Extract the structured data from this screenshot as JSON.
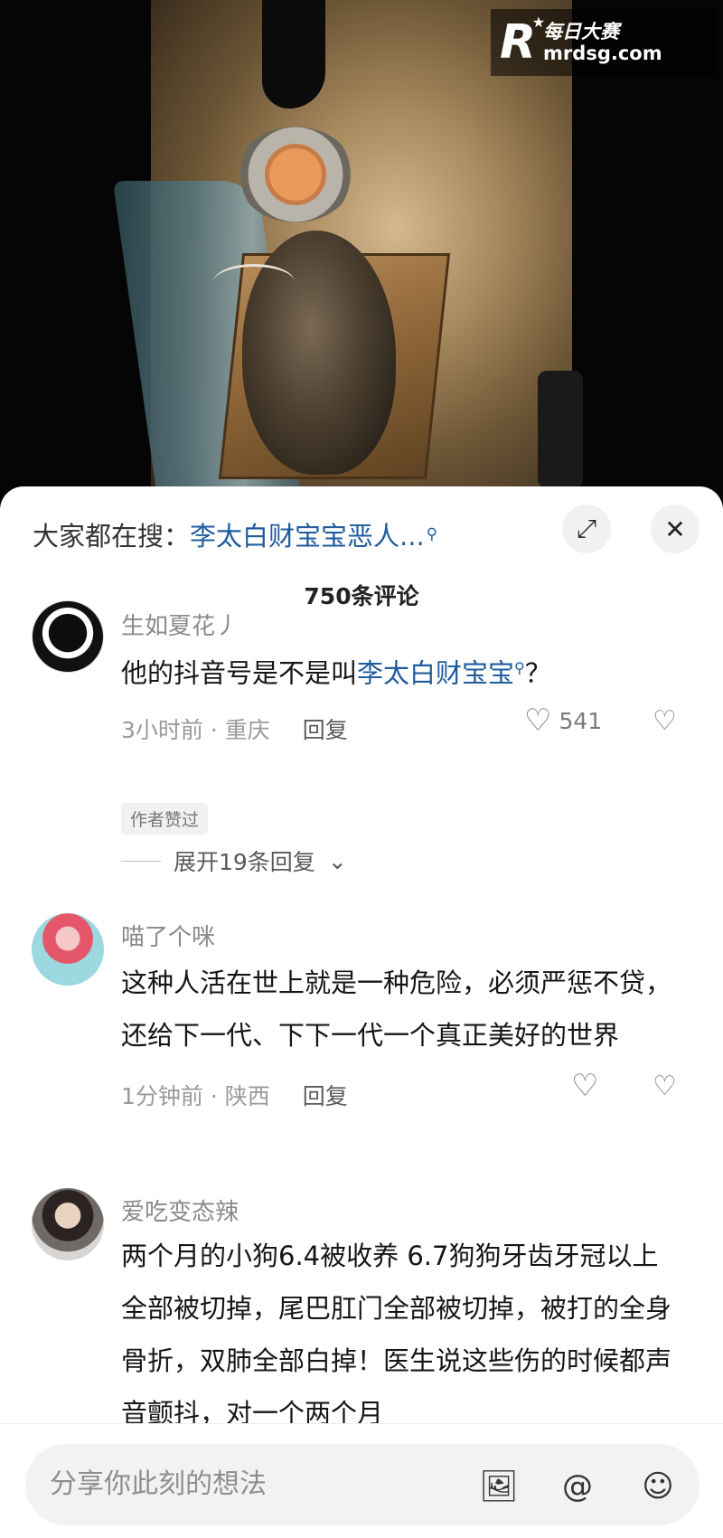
{
  "watermark": {
    "cn": "每日大赛",
    "url": "mrdsg.com",
    "logo": "R"
  },
  "sheet": {
    "search_prefix": "大家都在搜：",
    "search_term": "李太白财宝宝恶人...",
    "comment_count": "750条评论"
  },
  "comments": [
    {
      "user": "生如夏花丿",
      "text_before": "他的抖音号是不是叫",
      "text_link": "李太白财宝宝",
      "text_after": "？",
      "time_location": "3小时前 · 重庆",
      "reply_label": "回复",
      "likes": "541",
      "badge": "作者赞过",
      "expand_label": "展开19条回复"
    },
    {
      "user": "喵了个咪",
      "text": "这种人活在世上就是一种危险，必须严惩不贷，还给下一代、下下一代一个真正美好的世界",
      "time_location": "1分钟前 · 陕西",
      "reply_label": "回复"
    },
    {
      "user": "爱吃变态辣",
      "text": "两个月的小狗6.4被收养 6.7狗狗牙齿牙冠以上全部被切掉，尾巴肛门全部被切掉，被打的全身骨折，双肺全部白掉！医生说这些伤的时候都声音颤抖，对一个两个月"
    }
  ],
  "input": {
    "placeholder": "分享你此刻的想法"
  },
  "icons": {
    "expand": "expand-icon",
    "close": "close-icon",
    "like": "heart-icon",
    "dislike": "broken-heart-icon",
    "image": "image-icon",
    "mention": "at-icon",
    "emoji": "emoji-icon"
  }
}
